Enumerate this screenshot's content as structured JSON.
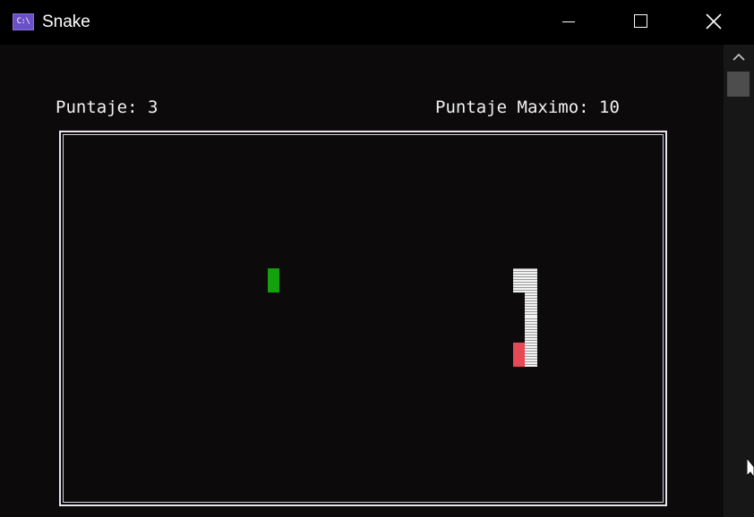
{
  "window": {
    "title": "Snake",
    "icon": "console-app-icon",
    "icon_glyph": "C:\\",
    "controls": [
      "minimize",
      "maximize",
      "close"
    ]
  },
  "hud": {
    "current_score": "Puntaje: 3",
    "max_score": "Puntaje Maximo: 10"
  },
  "game": {
    "grid_cells": {
      "cols": 50,
      "rows": 15
    },
    "food": {
      "col": 17,
      "row": 5,
      "color": "#13a10e"
    },
    "snake": {
      "head": {
        "col": 38,
        "row": 8,
        "color": "#e74856"
      },
      "body": [
        {
          "col": 38,
          "row": 5
        },
        {
          "col": 39,
          "row": 5
        },
        {
          "col": 39,
          "row": 6
        },
        {
          "col": 39,
          "row": 7
        },
        {
          "col": 39,
          "row": 8
        }
      ],
      "body_color": "#f2f2f2"
    },
    "border_color": "#e8e2ee",
    "background_color": "#0c0a0b"
  },
  "colors": {
    "titlebar": "#000000",
    "text": "#f2f2f2",
    "scrollbar_track": "#171717",
    "scrollbar_thumb": "#4d4d4d"
  }
}
